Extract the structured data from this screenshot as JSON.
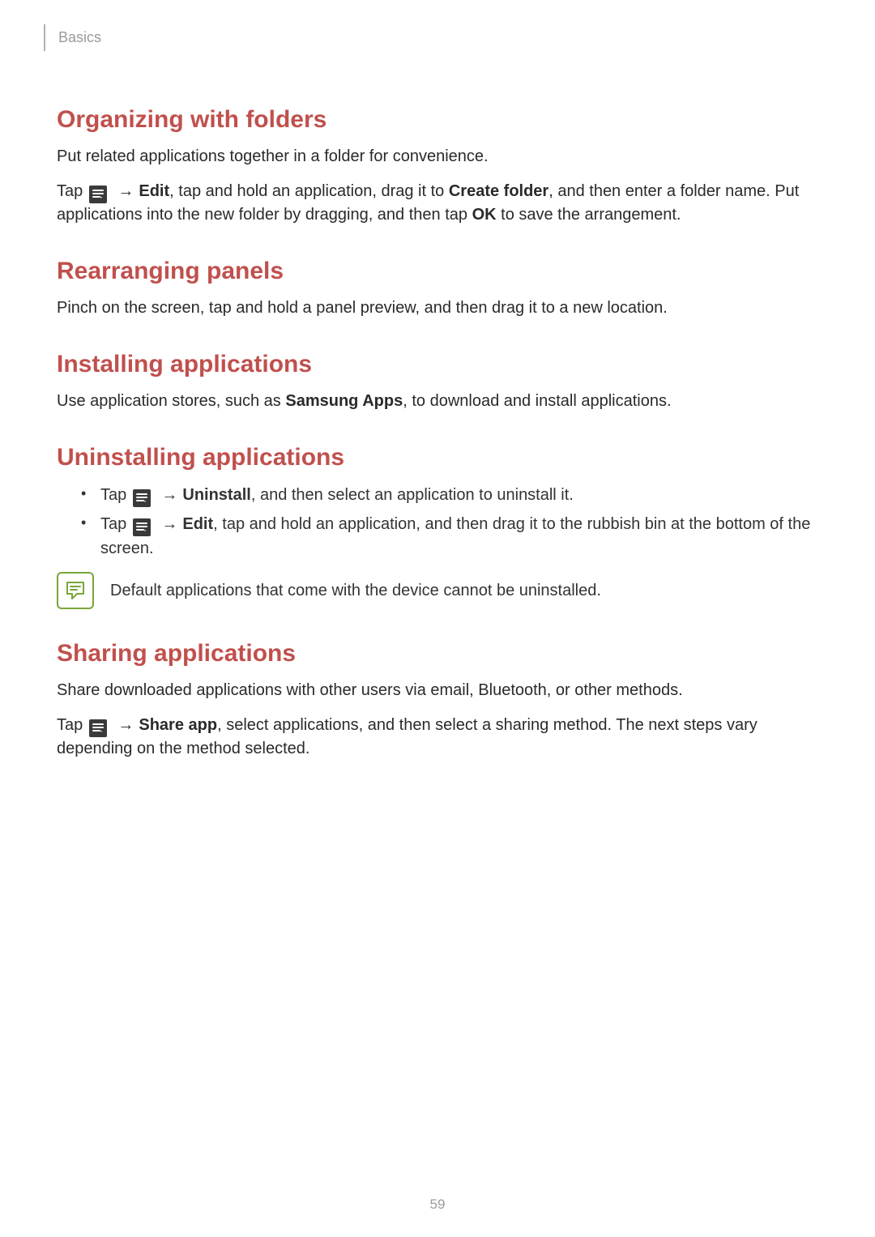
{
  "breadcrumb": "Basics",
  "page_number": "59",
  "arrow": "→",
  "sections": {
    "organizing": {
      "title": "Organizing with folders",
      "p1": "Put related applications together in a folder for convenience.",
      "p2a": "Tap ",
      "p2b_edit": "Edit",
      "p2c": ", tap and hold an application, drag it to ",
      "p2d_create": "Create folder",
      "p2e": ", and then enter a folder name. Put applications into the new folder by dragging, and then tap ",
      "p2f_ok": "OK",
      "p2g": " to save the arrangement."
    },
    "rearranging": {
      "title": "Rearranging panels",
      "p1": "Pinch on the screen, tap and hold a panel preview, and then drag it to a new location."
    },
    "installing": {
      "title": "Installing applications",
      "p1a": "Use application stores, such as ",
      "p1b_samsung": "Samsung Apps",
      "p1c": ", to download and install applications."
    },
    "uninstalling": {
      "title": "Uninstalling applications",
      "li1a": "Tap ",
      "li1b_uninstall": "Uninstall",
      "li1c": ", and then select an application to uninstall it.",
      "li2a": "Tap ",
      "li2b_edit": "Edit",
      "li2c": ", tap and hold an application, and then drag it to the rubbish bin at the bottom of the screen.",
      "note": "Default applications that come with the device cannot be uninstalled."
    },
    "sharing": {
      "title": "Sharing applications",
      "p1": "Share downloaded applications with other users via email, Bluetooth, or other methods.",
      "p2a": "Tap ",
      "p2b_share": "Share app",
      "p2c": ", select applications, and then select a sharing method. The next steps vary depending on the method selected."
    }
  }
}
